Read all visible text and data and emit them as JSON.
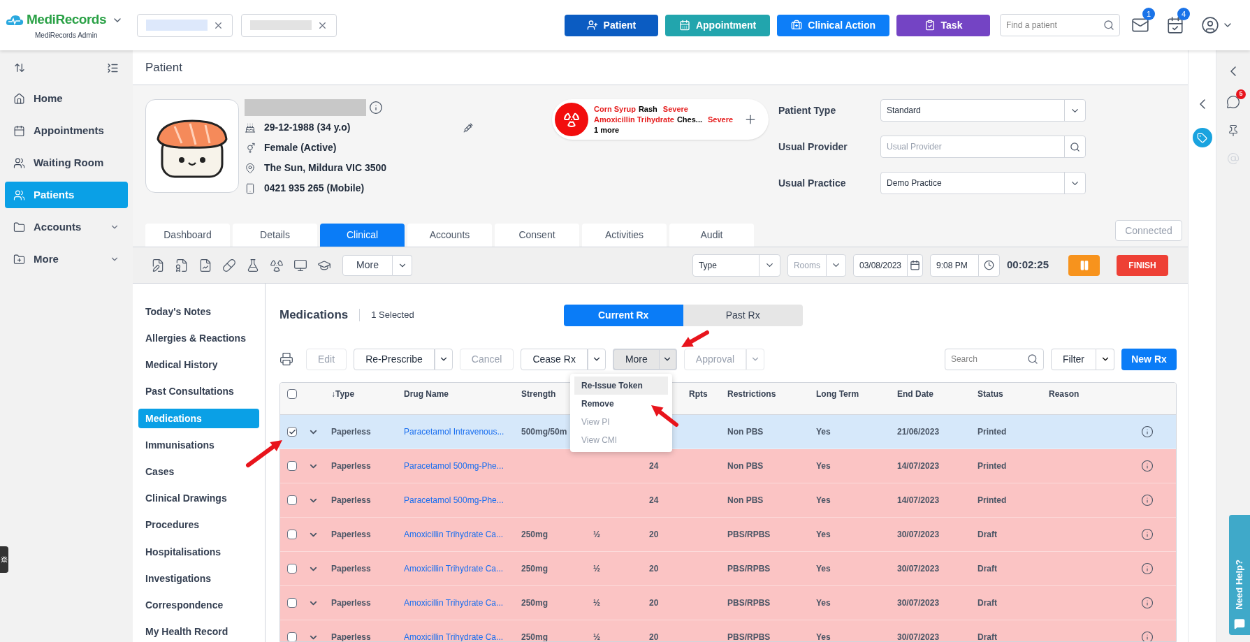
{
  "header": {
    "brand": "MediRecords",
    "subtitle": "MediRecords Admin",
    "open_tabs": [
      {
        "kind": "redacted"
      },
      {
        "kind": "redacted"
      }
    ],
    "actions": [
      {
        "label": "Patient",
        "color": "#0b5cc2"
      },
      {
        "label": "Appointment",
        "color": "#22a5ad"
      },
      {
        "label": "Clinical Action",
        "color": "#0d7ef8"
      },
      {
        "label": "Task",
        "color": "#7444c4"
      }
    ],
    "search": {
      "placeholder": "Find a patient"
    },
    "mail_badge": "1",
    "task_badge": "4"
  },
  "sidebar": {
    "items": [
      {
        "label": "Home",
        "selected": false,
        "expandable": false
      },
      {
        "label": "Appointments",
        "selected": false,
        "expandable": false
      },
      {
        "label": "Waiting Room",
        "selected": false,
        "expandable": false
      },
      {
        "label": "Patients",
        "selected": true,
        "expandable": false
      },
      {
        "label": "Accounts",
        "selected": false,
        "expandable": true
      },
      {
        "label": "More",
        "selected": false,
        "expandable": true
      }
    ]
  },
  "page_title": "Patient",
  "patient": {
    "details": [
      "29-12-1988 (34 y.o)",
      "Female (Active)",
      "The Sun, Mildura VIC 3500",
      "0421 935 265 (Mobile)"
    ],
    "allergies": [
      {
        "substance": "Corn Syrup",
        "reaction": "Rash",
        "severity": "Severe"
      },
      {
        "substance": "Amoxicillin Trihydrate",
        "reaction": "Ches...",
        "severity": "Severe"
      }
    ],
    "allergies_more": "1 more",
    "fields": [
      {
        "label": "Patient Type",
        "kind": "select",
        "value": "Standard"
      },
      {
        "label": "Usual Provider",
        "kind": "search",
        "placeholder": "Usual Provider"
      },
      {
        "label": "Usual Practice",
        "kind": "select",
        "value": "Demo Practice"
      }
    ],
    "connected_button": {
      "label": "Connected",
      "disabled": true
    }
  },
  "tabs": [
    {
      "label": "Dashboard",
      "selected": false
    },
    {
      "label": "Details",
      "selected": false
    },
    {
      "label": "Clinical",
      "selected": true
    },
    {
      "label": "Accounts",
      "selected": false
    },
    {
      "label": "Consent",
      "selected": false
    },
    {
      "label": "Activities",
      "selected": false
    },
    {
      "label": "Audit",
      "selected": false
    }
  ],
  "toolbar": {
    "more": "More",
    "type": {
      "value": "Type"
    },
    "rooms": {
      "placeholder": "Rooms"
    },
    "date": "03/08/2023",
    "time": "9:08 PM",
    "timer": "00:02:25",
    "finish": "FINISH"
  },
  "clinical_nav": [
    {
      "label": "Today's Notes",
      "selected": false
    },
    {
      "label": "Allergies & Reactions",
      "selected": false
    },
    {
      "label": "Medical History",
      "selected": false
    },
    {
      "label": "Past Consultations",
      "selected": false
    },
    {
      "label": "Medications",
      "selected": true
    },
    {
      "label": "Immunisations",
      "selected": false
    },
    {
      "label": "Cases",
      "selected": false
    },
    {
      "label": "Clinical Drawings",
      "selected": false
    },
    {
      "label": "Procedures",
      "selected": false
    },
    {
      "label": "Hospitalisations",
      "selected": false
    },
    {
      "label": "Investigations",
      "selected": false
    },
    {
      "label": "Correspondence",
      "selected": false
    },
    {
      "label": "My Health Record",
      "selected": false
    }
  ],
  "medications": {
    "title": "Medications",
    "selected_count": "1 Selected",
    "rx_tabs": [
      {
        "label": "Current Rx",
        "selected": true
      },
      {
        "label": "Past Rx",
        "selected": false
      }
    ],
    "actions": [
      {
        "label": "Edit",
        "kind": "button",
        "disabled": true,
        "open": false
      },
      {
        "label": "Re-Prescribe",
        "kind": "split",
        "disabled": false,
        "open": false
      },
      {
        "label": "Cancel",
        "kind": "button",
        "disabled": true,
        "open": false
      },
      {
        "label": "Cease Rx",
        "kind": "split",
        "disabled": false,
        "open": false
      },
      {
        "label": "More",
        "kind": "split",
        "disabled": false,
        "open": true
      },
      {
        "label": "Approval",
        "kind": "split",
        "disabled": true,
        "open": false
      }
    ],
    "search": {
      "placeholder": "Search"
    },
    "filter": "Filter",
    "new_button": "New Rx",
    "menu": [
      {
        "label": "Re-Issue Token",
        "disabled": false,
        "selected": true
      },
      {
        "label": "Remove",
        "disabled": false,
        "selected": false
      },
      {
        "label": "View PI",
        "disabled": true,
        "selected": false
      },
      {
        "label": "View CMI",
        "disabled": true,
        "selected": false
      }
    ],
    "table": {
      "all_selected": false,
      "columns": [
        "↓Type",
        "Drug Name",
        "Strength",
        "Rpts",
        "Restrictions",
        "Long Term",
        "End Date",
        "Status",
        "Reason"
      ],
      "rows": [
        {
          "selected": true,
          "type": "Paperless",
          "drug": "Paracetamol Intravenous...",
          "strength": "500mg/50m",
          "restrictions": "Non PBS",
          "long_term": "Yes",
          "end_date": "21/06/2023",
          "status": "Printed"
        },
        {
          "selected": false,
          "flagged": true,
          "type": "Paperless",
          "drug": "Paracetamol 500mg-Phe...",
          "column_6": "24",
          "restrictions": "Non PBS",
          "long_term": "Yes",
          "end_date": "14/07/2023",
          "status": "Printed"
        },
        {
          "selected": false,
          "flagged": true,
          "type": "Paperless",
          "drug": "Paracetamol 500mg-Phe...",
          "column_6": "24",
          "restrictions": "Non PBS",
          "long_term": "Yes",
          "end_date": "14/07/2023",
          "status": "Printed"
        },
        {
          "selected": false,
          "flagged": true,
          "type": "Paperless",
          "drug": "Amoxicillin Trihydrate Ca...",
          "strength": "250mg",
          "column_5": "½",
          "column_6": "20",
          "restrictions": "PBS/RPBS",
          "long_term": "Yes",
          "end_date": "30/07/2023",
          "status": "Draft"
        },
        {
          "selected": false,
          "flagged": true,
          "type": "Paperless",
          "drug": "Amoxicillin Trihydrate Ca...",
          "strength": "250mg",
          "column_5": "½",
          "column_6": "20",
          "restrictions": "PBS/RPBS",
          "long_term": "Yes",
          "end_date": "30/07/2023",
          "status": "Draft"
        },
        {
          "selected": false,
          "flagged": true,
          "type": "Paperless",
          "drug": "Amoxicillin Trihydrate Ca...",
          "strength": "250mg",
          "column_5": "½",
          "column_6": "20",
          "restrictions": "PBS/RPBS",
          "long_term": "Yes",
          "end_date": "30/07/2023",
          "status": "Draft"
        },
        {
          "selected": false,
          "flagged": true,
          "type": "Paperless",
          "drug": "Amoxicillin Trihydrate Ca...",
          "strength": "250mg",
          "column_5": "½",
          "column_6": "20",
          "restrictions": "PBS/RPBS",
          "long_term": "Yes",
          "end_date": "30/07/2023",
          "status": "Draft"
        }
      ]
    }
  },
  "right_panel": {
    "chat_badge": "5",
    "help": "Need Help?"
  }
}
